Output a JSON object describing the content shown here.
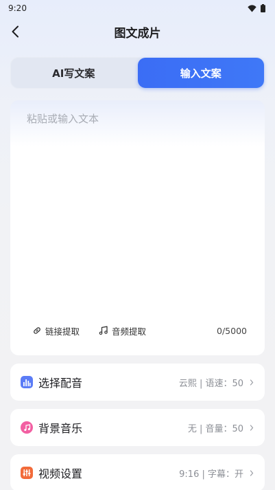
{
  "status_bar": {
    "time": "9:20"
  },
  "header": {
    "title": "图文成片"
  },
  "tabs": [
    {
      "label": "AI写文案",
      "active": false
    },
    {
      "label": "输入文案",
      "active": true
    }
  ],
  "editor": {
    "placeholder": "粘贴或输入文本",
    "tools": [
      {
        "label": "链接提取",
        "icon": "link-icon"
      },
      {
        "label": "音频提取",
        "icon": "music-note-icon"
      }
    ],
    "counter": "0/5000"
  },
  "settings": [
    {
      "label": "选择配音",
      "value": "云熙 | 语速：50",
      "icon": "voice-bars-icon",
      "color": "#5b7cf6"
    },
    {
      "label": "背景音乐",
      "value": "无 | 音量：50",
      "icon": "music-icon",
      "color": "#f25fa2"
    },
    {
      "label": "视频设置",
      "value": "9:16 | 字幕：开",
      "icon": "sliders-icon",
      "color": "#f26b3a"
    }
  ],
  "colors": {
    "accent": "#3b6df5"
  }
}
